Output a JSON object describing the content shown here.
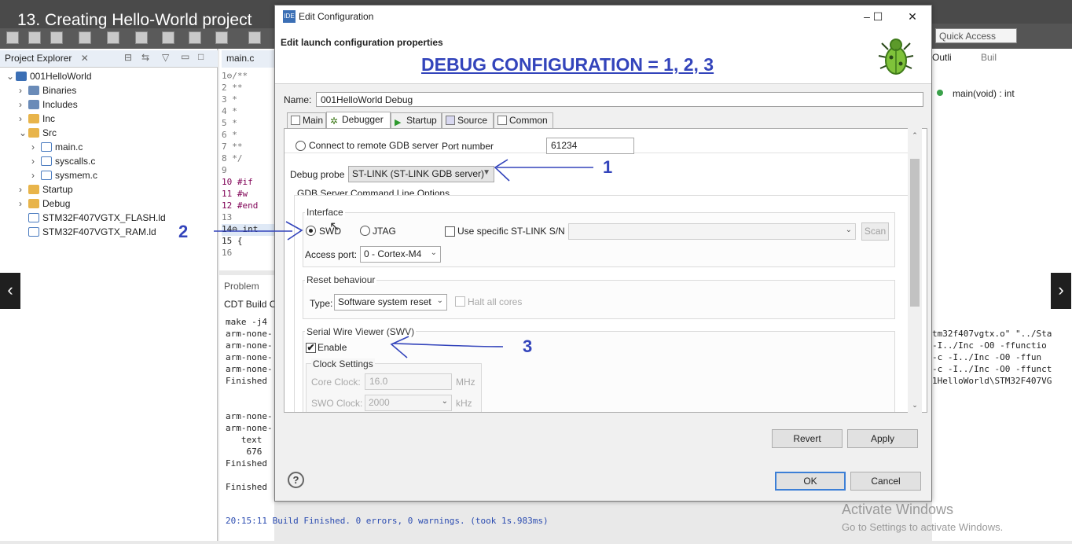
{
  "video": {
    "title": "13. Creating Hello-World project"
  },
  "quick_access": "Quick Access",
  "project_explorer": {
    "tab_label": "Project Explorer",
    "items": [
      {
        "label": "001HelloWorld",
        "icon": "project-icon"
      },
      {
        "label": "Binaries",
        "icon": "binaries-icon"
      },
      {
        "label": "Includes",
        "icon": "includes-icon"
      },
      {
        "label": "Inc",
        "icon": "folder-icon"
      },
      {
        "label": "Src",
        "icon": "folder-icon"
      },
      {
        "label": "main.c",
        "icon": "c-file-icon"
      },
      {
        "label": "syscalls.c",
        "icon": "c-file-icon"
      },
      {
        "label": "sysmem.c",
        "icon": "c-file-icon"
      },
      {
        "label": "Startup",
        "icon": "folder-icon"
      },
      {
        "label": "Debug",
        "icon": "folder-icon"
      },
      {
        "label": "STM32F407VGTX_FLASH.ld",
        "icon": "ld-file-icon"
      },
      {
        "label": "STM32F407VGTX_RAM.ld",
        "icon": "ld-file-icon"
      }
    ]
  },
  "editor": {
    "tab_label": "main.c",
    "lines": [
      "1⊖/**",
      "2    **",
      "3    *",
      "4    *",
      "5    *",
      "6    *",
      "7    **",
      "8  */",
      "9",
      "10  #if",
      "11    #w",
      "12  #end",
      "13",
      "14⊖ int",
      "15  {",
      "16"
    ]
  },
  "console": {
    "tab_label": "Problem",
    "title": "CDT Build C",
    "lines": [
      "make -j4",
      "arm-none-",
      "arm-none-",
      "arm-none-",
      "arm-none-",
      "Finished",
      "",
      "arm-none-",
      "arm-none-",
      "   text",
      "    676",
      "Finished",
      "",
      "Finished"
    ],
    "right_lines": [
      "tm32f407vgtx.o\" \"../Sta",
      "-I../Inc -O0 -ffunctio",
      "-c -I../Inc -O0 -ffun",
      "-c -I../Inc -O0 -ffunct",
      "1HelloWorld\\STM32F407VG"
    ],
    "status_line": "20:15:11 Build Finished. 0 errors, 0 warnings. (took 1s.983ms)"
  },
  "outline": {
    "tab_label": "Outli",
    "build_label": "Buil",
    "item": "main(void) : int"
  },
  "watermark": {
    "line1": "Activate Windows",
    "line2": "Go to Settings to activate Windows."
  },
  "dialog": {
    "title": "Edit Configuration",
    "subtitle": "Edit launch configuration properties",
    "annotation_heading": "DEBUG CONFIGURATION = 1, 2, 3",
    "name_label": "Name:",
    "name_value": "001HelloWorld Debug",
    "tabs": [
      "Main",
      "Debugger",
      "Startup",
      "Source",
      "Common"
    ],
    "active_tab": "Debugger",
    "connect_remote_label": "Connect to remote GDB server",
    "port_label": "Port number",
    "port_value": "61234",
    "debug_probe_label": "Debug probe",
    "debug_probe_value": "ST-LINK (ST-LINK GDB server)",
    "gdb_group_label": "GDB Server Command Line Options",
    "interface_label": "Interface",
    "swd_label": "SWD",
    "jtag_label": "JTAG",
    "use_sn_label": "Use specific ST-LINK S/N",
    "scan_label": "Scan",
    "access_port_label": "Access port:",
    "access_port_value": "0 - Cortex-M4",
    "reset_group_label": "Reset behaviour",
    "reset_type_label": "Type:",
    "reset_type_value": "Software system reset",
    "halt_label": "Halt all cores",
    "swv_group_label": "Serial Wire Viewer (SWV)",
    "enable_label": "Enable",
    "clock_group_label": "Clock Settings",
    "core_clock_label": "Core Clock:",
    "core_clock_value": "16.0",
    "core_clock_unit": "MHz",
    "swo_clock_label": "SWO Clock:",
    "swo_clock_value": "2000",
    "swo_clock_unit": "kHz",
    "revert_label": "Revert",
    "apply_label": "Apply",
    "ok_label": "OK",
    "cancel_label": "Cancel",
    "help_label": "?"
  },
  "annotations": {
    "one": "1",
    "two": "2",
    "three": "3"
  },
  "colors": {
    "annotation": "#3344bb",
    "ide_dark": "#4a4a4a",
    "dialog_bg": "#f0f0f0"
  }
}
